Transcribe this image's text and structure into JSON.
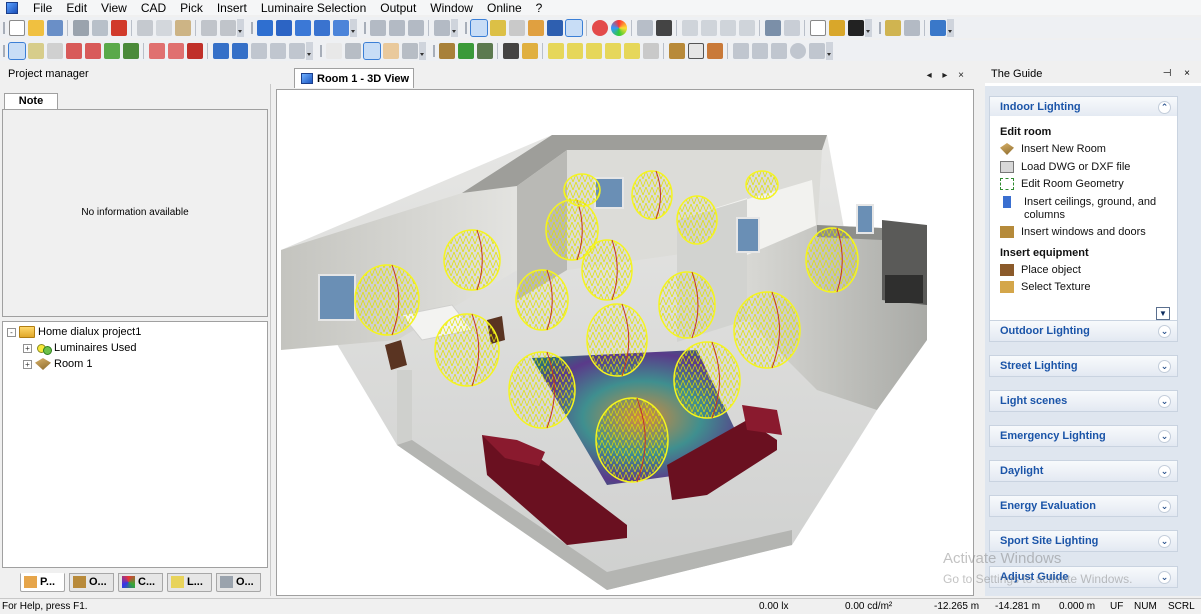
{
  "menu": {
    "items": [
      "File",
      "Edit",
      "View",
      "CAD",
      "Pick",
      "Insert",
      "Luminaire Selection",
      "Output",
      "Window",
      "Online",
      "?"
    ]
  },
  "left_panel": {
    "title": "Project manager",
    "note_tab": "Note",
    "note_empty": "No information available",
    "tree": [
      {
        "label": "Home dialux project1",
        "icon": "folder-icon",
        "expander": "-"
      },
      {
        "label": "Luminaires Used",
        "icon": "luminaire-icon",
        "expander": "+"
      },
      {
        "label": "Room 1",
        "icon": "room-icon",
        "expander": "+"
      }
    ],
    "bottom_tabs": [
      "P...",
      "O...",
      "C...",
      "L...",
      "O..."
    ]
  },
  "view": {
    "tab_label": "Room 1 - 3D View",
    "controls": "◂ ▸ ×"
  },
  "guide": {
    "title": "The Guide",
    "header_controls": "⊣ ×",
    "expanded_section": "Indoor Lighting",
    "subsections": [
      {
        "title": "Edit room",
        "items": [
          "Insert New Room",
          "Load DWG or DXF file",
          "Edit Room Geometry",
          "Insert ceilings, ground, and columns",
          "Insert windows and doors"
        ]
      },
      {
        "title": "Insert equipment",
        "items": [
          "Place object",
          "Select Texture"
        ]
      }
    ],
    "collapsed_sections": [
      "Outdoor Lighting",
      "Street Lighting",
      "Light scenes",
      "Emergency Lighting",
      "Daylight",
      "Energy Evaluation",
      "Sport Site Lighting",
      "Adjust Guide"
    ]
  },
  "watermark": {
    "line1": "Activate Windows",
    "line2": "Go to Settings to activate Windows."
  },
  "status": {
    "help": "For Help, press F1.",
    "illuminance": "0.00 lx",
    "luminance": "0.00 cd/m²",
    "x": "-12.265 m",
    "y": "-14.281 m",
    "z": "0.000 m",
    "uf": "UF",
    "num": "NUM",
    "scrl": "SCRL"
  },
  "colors": {
    "accent": "#1a54a8",
    "luminaire": "#f5f51e",
    "rug": "#3a8a8a",
    "sofa": "#6a1020"
  }
}
